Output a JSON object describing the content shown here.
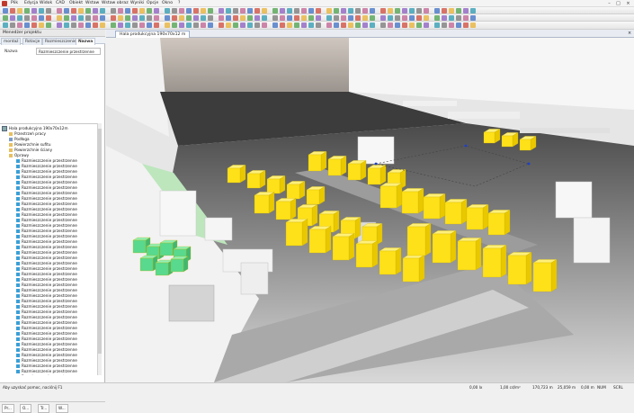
{
  "menubar": {
    "items": [
      "Plik",
      "Edycja",
      "Widok",
      "CAD",
      "Obiekt",
      "Wstaw",
      "Wstaw obraz",
      "Wyniki",
      "Opcje",
      "Okno",
      "?"
    ],
    "window_controls": [
      "–",
      "□",
      "×"
    ]
  },
  "left_panel": {
    "header": "Menedżer projektu",
    "tabs": [
      "montaż",
      "Rotacje",
      "Rozmieszczenie",
      "Nazwa"
    ],
    "active_tab": "Nazwa",
    "property_label": "Nazwa",
    "property_value": "Rozmieszczenie przestrzenne",
    "tree_root": "Hala produkcyjna 190x70x12m",
    "tree_children": [
      "Przestrzeń pracy",
      "Podłoga",
      "Powierzchnie sufitu",
      "Powierzchnie ściany",
      "Oprawy"
    ],
    "tree_leaf": "Rozmieszczenie przestrzenne",
    "bottom_tabs": [
      "Pr...",
      "O...",
      "Tr...",
      "W..."
    ]
  },
  "document": {
    "tab_title": "Hala produkcyjna 190x70x12 m",
    "close": "×"
  },
  "statusbar": {
    "message": "Aby uzyskać pomoc, naciśnij F1",
    "value1": "0,00 lx",
    "value2": "1,00 cd/m²",
    "coord_x": "170,723 m",
    "coord_y": "25,059 m",
    "coord_z": "0,00 m",
    "caps": "NUM",
    "scrl": "SCRL"
  },
  "colors": {
    "luminaire_yellow": "#ffe11a",
    "luminaire_green": "#58d98e",
    "wall_white": "#f2f2f2",
    "floor_grey": "#8a8a8a"
  }
}
